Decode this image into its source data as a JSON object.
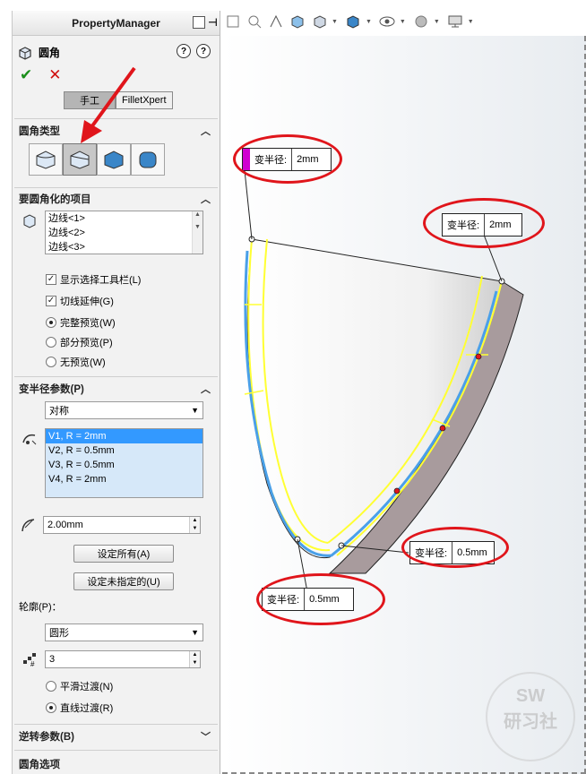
{
  "panel": {
    "header_title": "PropertyManager",
    "feature_title": "圆角",
    "tabs": [
      "手工",
      "FilletXpert"
    ],
    "sections": {
      "fillet_type": "圆角类型",
      "items_to_fillet": "要圆角化的项目",
      "variable_radius": "变半径参数(P)",
      "reverse_params": "逆转参数(B)",
      "fillet_options": "圆角选项"
    },
    "edges": [
      "边线<1>",
      "边线<2>",
      "边线<3>"
    ],
    "checkboxes": [
      {
        "label": "显示选择工具栏(L)",
        "checked": true
      },
      {
        "label": "切线延伸(G)",
        "checked": true
      }
    ],
    "preview_options": [
      {
        "label": "完整预览(W)",
        "selected": true
      },
      {
        "label": "部分预览(P)",
        "selected": false
      },
      {
        "label": "无预览(W)",
        "selected": false
      }
    ],
    "symmetry_select": "对称",
    "vertices": [
      "V1, R = 2mm",
      "V2, R = 0.5mm",
      "V3, R = 0.5mm",
      "V4, R = 2mm"
    ],
    "radius_value": "2.00mm",
    "set_all_button": "设定所有(A)",
    "set_unassigned_button": "设定未指定的(U)",
    "profile_label": "轮廓(P)：",
    "profile_select": "圆形",
    "instances_value": "3",
    "transition_options": [
      {
        "label": "平滑过渡(N)",
        "selected": false
      },
      {
        "label": "直线过渡(R)",
        "selected": true
      }
    ]
  },
  "callouts": [
    {
      "label": "变半径:",
      "value": "2mm"
    },
    {
      "label": "变半径:",
      "value": "2mm"
    },
    {
      "label": "变半径:",
      "value": "0.5mm"
    },
    {
      "label": "变半径:",
      "value": "0.5mm"
    }
  ],
  "watermark": {
    "line1": "SW",
    "line2": "研习社"
  },
  "colors": {
    "accent_red": "#e0151b",
    "selection_blue": "#3399ff",
    "edge_yellow": "#ffff33",
    "edge_blue": "#4aa0e8"
  }
}
